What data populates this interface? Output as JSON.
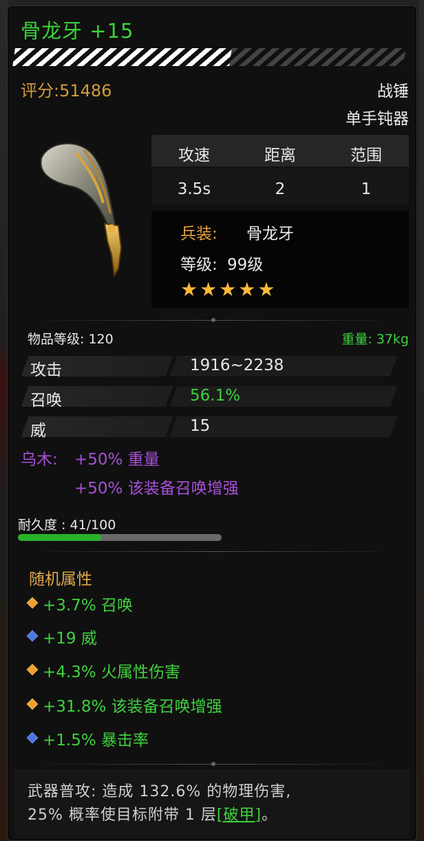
{
  "item": {
    "name": "骨龙牙 +15",
    "score": "评分:51486",
    "weapon_class": "战锤",
    "weapon_subclass": "单手钝器",
    "stat_headers": [
      "攻速",
      "距离",
      "范围"
    ],
    "stat_values": [
      "3.5s",
      "2",
      "1"
    ],
    "info": {
      "soldier_label": "兵装:",
      "soldier_value": "骨龙牙",
      "level_label": "等级:",
      "level_value": "99级",
      "stars": 5,
      "stars_text": "★★★★★"
    },
    "item_level": "物品等级: 120",
    "weight": "重量: 37kg",
    "attributes": [
      {
        "name": "攻击",
        "value": "1916~2238",
        "value_color": "#e8e8e8"
      },
      {
        "name": "召唤",
        "value": "56.1%",
        "value_color": "#3fd13f"
      },
      {
        "name": "威",
        "value": "15",
        "value_color": "#e8e8e8"
      }
    ],
    "set_bonus": {
      "label": "乌木:",
      "line1": "+50% 重量",
      "line2": "+50% 该装备召唤增强"
    },
    "durability": {
      "label": "耐久度 : 41/100",
      "fraction": 0.41
    },
    "random_attributes_title": "随机属性",
    "random_attributes": [
      {
        "text": "+3.7% 召唤",
        "gem": "gold"
      },
      {
        "text": "+19 威",
        "gem": "blue"
      },
      {
        "text": "+4.3% 火属性伤害",
        "gem": "gold"
      },
      {
        "text": "+31.8% 该装备召唤增强",
        "gem": "gold"
      },
      {
        "text": "+1.5% 暴击率",
        "gem": "blue"
      }
    ],
    "description": {
      "line1": "武器普攻: 造成 132.6% 的物理伤害,",
      "line2_prefix": "25% 概率使目标附带 1 层",
      "link": "[破甲]",
      "line2_suffix": "。"
    }
  },
  "colors": {
    "title_green": "#39d339",
    "score_gold": "#d39a3c",
    "set_purple": "#a84fd6",
    "bonus_green": "#3fd13f",
    "star_gold": "#ffb938"
  }
}
